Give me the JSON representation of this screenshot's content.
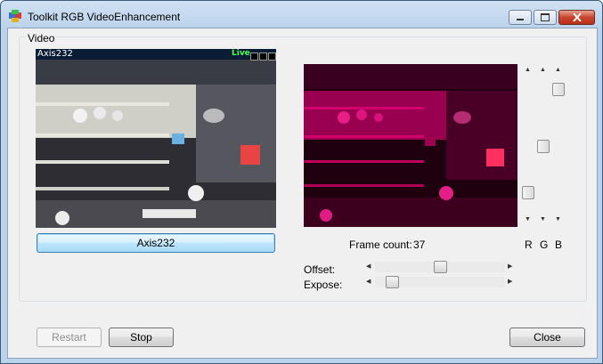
{
  "window": {
    "title": "Toolkit RGB VideoEnhancement"
  },
  "video_group": {
    "label": "Video"
  },
  "left_video": {
    "overlay_label": "Axis232",
    "live_label": "Live"
  },
  "camera_button": {
    "label": "Axis232"
  },
  "frame_count": {
    "label": "Frame count:",
    "value": "37"
  },
  "channels": {
    "r_label": "R",
    "g_label": "G",
    "b_label": "B",
    "r_level": 0.9,
    "g_level": 0.51,
    "b_level": 0.03
  },
  "sliders": {
    "offset_label": "Offset:",
    "offset_level": 0.5,
    "expose_label": "Expose:",
    "expose_level": 0.09
  },
  "buttons": {
    "restart": "Restart",
    "stop": "Stop",
    "close": "Close"
  },
  "colors": {
    "processed_tint": "#d4006e",
    "focus_border": "#3c7fb1"
  }
}
